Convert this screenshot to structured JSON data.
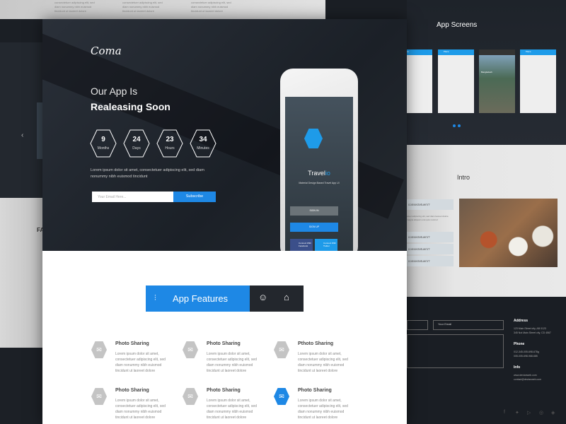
{
  "hero": {
    "logo": "Coma",
    "headline_1": "Our App Is",
    "headline_2": "Realeasing Soon",
    "countdown": [
      {
        "value": "9",
        "unit": "Months"
      },
      {
        "value": "24",
        "unit": "Days"
      },
      {
        "value": "23",
        "unit": "Hours"
      },
      {
        "value": "34",
        "unit": "Minutes"
      }
    ],
    "description": "Lorem ipsum dolor sit amet, consectetuer adipiscing elit, sed diam nonummy nibh euismod tincidunt",
    "email_placeholder": "Your Email Here...",
    "subscribe_label": "Subscribe"
  },
  "phone": {
    "app_name_a": "Travel",
    "app_name_b": "io",
    "tagline": "Material Design Based Travel App UI",
    "sign_in": "SIGN IN",
    "sign_up": "SIGN UP",
    "facebook": "Connect With Facebook",
    "twitter": "Connect With Twitter"
  },
  "features": {
    "tab_label": "App Features",
    "tab_icons": [
      "sliders-icon",
      "user-icon",
      "store-icon"
    ],
    "items": [
      {
        "title": "Photo Sharing",
        "text": "Lorem ipsum dolor sit amet, consectetuer adipiscing elit, sed diam nonummy nibh euismod tincidunt ut laoreet dolore",
        "active": false
      },
      {
        "title": "Photo Sharing",
        "text": "Lorem ipsum dolor sit amet, consectetuer adipiscing elit, sed diam nonummy nibh euismod tincidunt ut laoreet dolore",
        "active": false
      },
      {
        "title": "Pthoto Sharing",
        "text": "Lorem ipsum dolor sit amet, consectetuer adipiscing elit, sed diam nonummy nibh euismod tincidunt ut laoreet dolore",
        "active": false
      },
      {
        "title": "Photo Sharing",
        "text": "Lorem ipsum dolor sit amet, consectetuer adipiscing elit, sed diam nonummy nibh euismod tincidunt ut laoreet dolore",
        "active": false
      },
      {
        "title": "Photo Sharing",
        "text": "Lorem ipsum dolor sit amet, consectetuer adipiscing elit, sed diam nonummy nibh euismod tincidunt ut laoreet dolore",
        "active": false
      },
      {
        "title": "Photo Sharing",
        "text": "Lorem ipsum dolor sit amet, consectetuer adipiscing elit, sed diam nonummy nibh euismod tincidunt ut laoreet dolore",
        "active": true
      }
    ]
  },
  "top_strip": {
    "texts": [
      "consectetuer adipiscing elit, sed diam nonummy nibh euismod tincidunt ut laoreet dolore",
      "consectetuer adipiscing elit, sed diam nonummy nibh euismod tincidunt ut laoreet dolore",
      "consectetuer adipiscing elit, sed diam nonummy nibh euismod tincidunt ut laoreet dolore"
    ]
  },
  "left_panel": {
    "heading_fragment": "FA"
  },
  "app_screens": {
    "title": "App Screens",
    "screens": [
      "Home",
      "Place",
      "Bangladesh",
      "Place"
    ]
  },
  "intro": {
    "title": "Intro",
    "faq": [
      "consectetuem?",
      "consectetuem?",
      "consectetuem?",
      "consectetuem?"
    ],
    "faq_answer": "etuer adipiscing elit, sed diam laoreet dolore magna aliquam erat quis nostrud"
  },
  "footer": {
    "email_placeholder": "Your Email",
    "address_title": "Address",
    "address": [
      "123 Main Street city, AB 0123",
      "345 Not Main Street city, CD 4567"
    ],
    "phone_title": "Phone",
    "phones": [
      "012-345-005-698-678g",
      "005-005-698-968-685"
    ],
    "info_title": "Info",
    "info": [
      "www.devianweb.com",
      "contact@devianweb.com"
    ],
    "social_icons": [
      "facebook-icon",
      "twitter-icon",
      "youtube-icon",
      "dribbble-icon",
      "dropbox-icon"
    ]
  },
  "colors": {
    "accent": "#1e88e5",
    "dark": "#1e232a",
    "icon_gray": "#c4c4c4"
  }
}
